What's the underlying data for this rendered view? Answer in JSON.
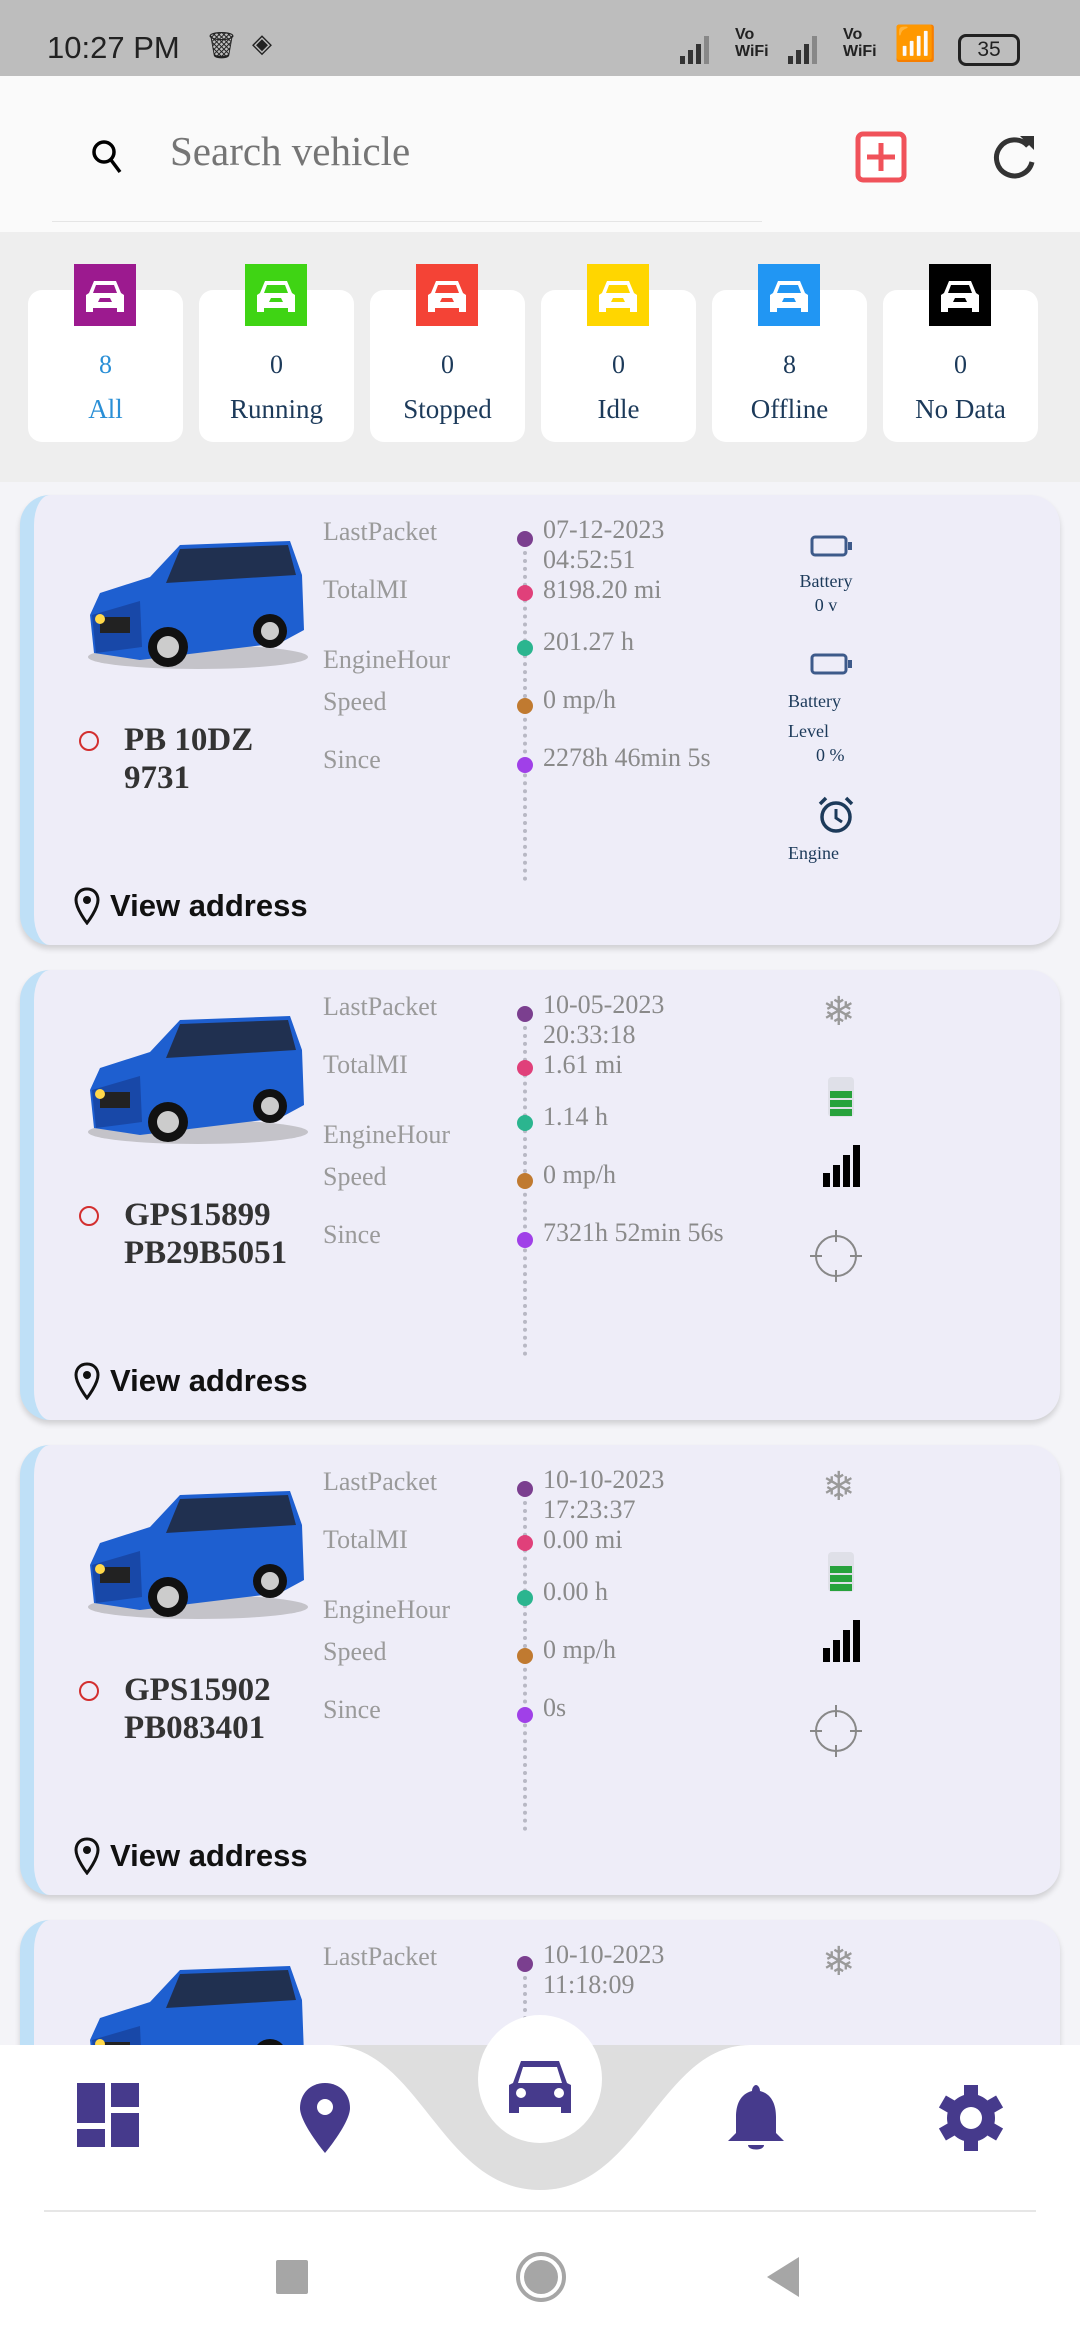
{
  "status_bar": {
    "time": "10:27 PM",
    "battery": "35",
    "net1": "Vo WiFi",
    "net2": "Vo WiFi"
  },
  "header": {
    "search_placeholder": "Search vehicle",
    "add_icon": "plus-square-icon",
    "refresh_icon": "refresh-icon"
  },
  "filters": [
    {
      "count": "8",
      "label": "All",
      "color": "#9c1a8f",
      "text_color": "#2a8fd6"
    },
    {
      "count": "0",
      "label": "Running",
      "color": "#3fd414",
      "text_color": "#1c3a5a"
    },
    {
      "count": "0",
      "label": "Stopped",
      "color": "#f44336",
      "text_color": "#1c3a5a"
    },
    {
      "count": "0",
      "label": "Idle",
      "color": "#ffd600",
      "text_color": "#1c3a5a"
    },
    {
      "count": "8",
      "label": "Offline",
      "color": "#2196f3",
      "text_color": "#1c3a5a"
    },
    {
      "count": "0",
      "label": "No Data",
      "color": "#000000",
      "text_color": "#1c3a5a"
    }
  ],
  "labels": {
    "last_packet": "LastPacket",
    "total": "TotalMI",
    "engine_hour": "EngineHour",
    "speed": "Speed",
    "since": "Since",
    "view_address": "View address"
  },
  "vehicles": [
    {
      "name": "PB 10DZ 9731",
      "last_date": "07-12-2023",
      "last_time": "04:52:51",
      "total": "8198.20 mi",
      "engine_hour": "201.27 h",
      "speed": "0 mp/h",
      "since": "2278h 46min 5s",
      "side": {
        "battery_label": "Battery",
        "battery_value": "0 v",
        "level_label1": "Battery",
        "level_label2": "Level",
        "level_value": "0 %",
        "engine_label": "Engine",
        "engine_value": ".."
      }
    },
    {
      "name": "GPS15899 PB29B5051",
      "last_date": "10-05-2023",
      "last_time": "20:33:18",
      "total": "1.61 mi",
      "engine_hour": "1.14 h",
      "speed": "0 mp/h",
      "since": "7321h 52min 56s"
    },
    {
      "name": "GPS15902 PB083401",
      "last_date": "10-10-2023",
      "last_time": "17:23:37",
      "total": "0.00 mi",
      "engine_hour": "0.00 h",
      "speed": "0 mp/h",
      "since": "0s"
    },
    {
      "name": "",
      "last_date": "10-10-2023",
      "last_time": "11:18:09"
    }
  ],
  "bottom_nav": [
    {
      "icon": "dashboard-icon"
    },
    {
      "icon": "map-pin-icon"
    },
    {
      "icon": "car-icon",
      "active": true
    },
    {
      "icon": "bell-icon"
    },
    {
      "icon": "gear-icon"
    }
  ],
  "colors": {
    "nav": "#463a8c",
    "card_bg": "#eeedf8",
    "accent_border": "#bfe0f7"
  }
}
